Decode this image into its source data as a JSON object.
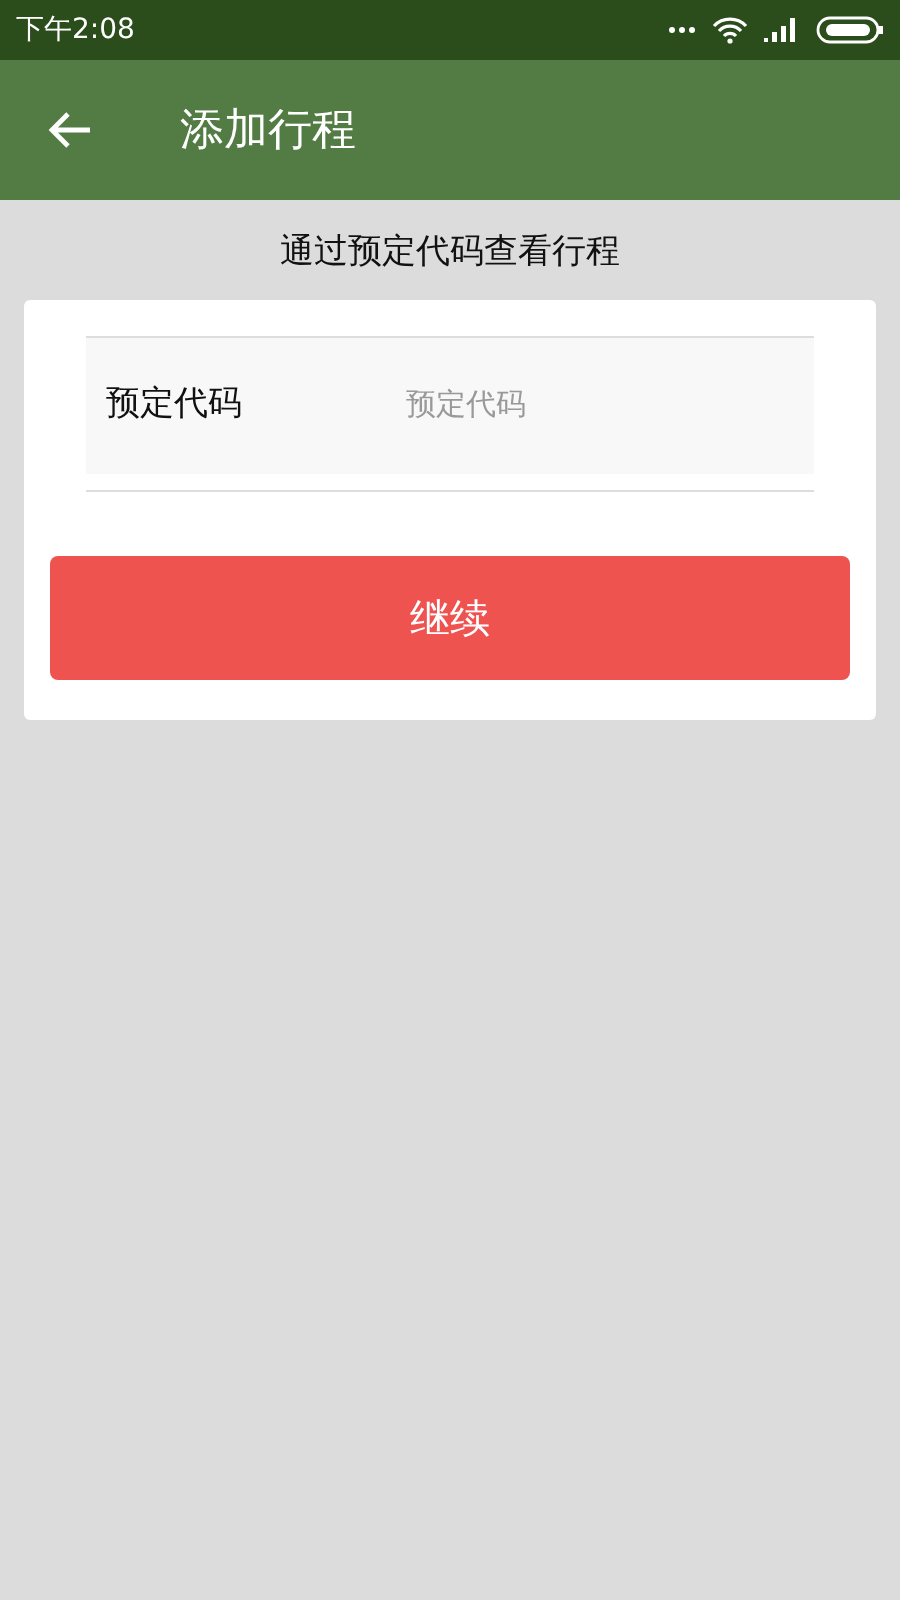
{
  "status_bar": {
    "time": "下午2:08"
  },
  "app_bar": {
    "title": "添加行程"
  },
  "subtitle": "通过预定代码查看行程",
  "form": {
    "label": "预定代码",
    "placeholder": "预定代码"
  },
  "buttons": [
    "继续"
  ]
}
